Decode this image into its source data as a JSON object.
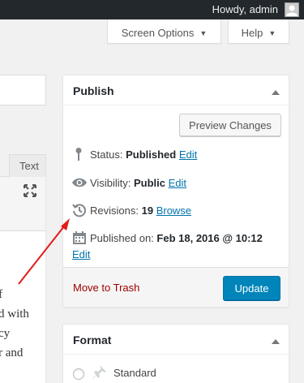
{
  "admin_bar": {
    "greeting": "Howdy, admin"
  },
  "screen_meta": {
    "screen_options_label": "Screen Options",
    "help_label": "Help"
  },
  "editor": {
    "text_tab_label": "Text",
    "lines": [
      "f",
      "d with",
      "cy",
      "r and"
    ]
  },
  "publish": {
    "title": "Publish",
    "preview_label": "Preview Changes",
    "status_label": "Status:",
    "status_value": "Published",
    "visibility_label": "Visibility:",
    "visibility_value": "Public",
    "revisions_label": "Revisions:",
    "revisions_value": "19",
    "browse_label": "Browse",
    "published_on_label": "Published on:",
    "published_on_value": "Feb 18, 2016 @ 10:12",
    "edit_label": "Edit",
    "trash_label": "Move to Trash",
    "update_label": "Update"
  },
  "format": {
    "title": "Format",
    "option_standard": "Standard"
  },
  "icons": {
    "avatar": "avatar-icon",
    "pin": "pin-icon",
    "visibility": "eye-icon",
    "revisions": "history-icon",
    "published_on": "calendar-icon",
    "fullscreen": "fullscreen-icon",
    "collapse": "arrow-up-icon",
    "format_standard": "pushpin-icon"
  },
  "colors": {
    "admin_bar_bg": "#23282d",
    "link": "#0073aa",
    "primary_button": "#0085ba",
    "trash": "#a00000",
    "annotation_arrow": "#e21b1b"
  }
}
